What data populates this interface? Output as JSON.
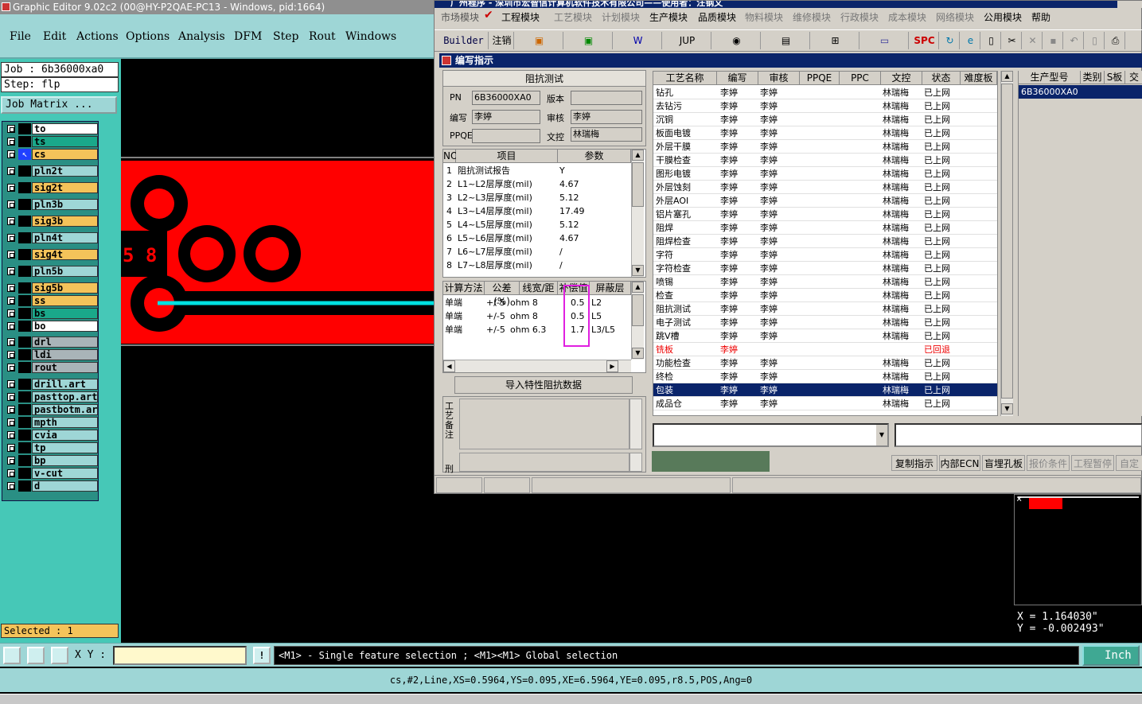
{
  "editor": {
    "title": "Graphic Editor 9.02c2 (00@HY-P2QAE-PC13 - Windows, pid:1664)",
    "menu": [
      "File",
      "Edit",
      "Actions",
      "Options",
      "Analysis",
      "DFM",
      "Step",
      "Rout",
      "Windows"
    ],
    "job": "Job : 6b36000xa0",
    "step": "Step: flp",
    "job_matrix": "Job Matrix ...",
    "layers": [
      {
        "name": "to",
        "color": "#ffffff"
      },
      {
        "name": "ts",
        "color": "#1aa88a"
      },
      {
        "name": "cs",
        "color": "#f4c35a"
      },
      {
        "name": "pln2t",
        "color": "#9ed6d6"
      },
      {
        "name": "sig2t",
        "color": "#f4c35a"
      },
      {
        "name": "pln3b",
        "color": "#9ed6d6"
      },
      {
        "name": "sig3b",
        "color": "#f4c35a"
      },
      {
        "name": "pln4t",
        "color": "#9ed6d6"
      },
      {
        "name": "sig4t",
        "color": "#f4c35a"
      },
      {
        "name": "pln5b",
        "color": "#9ed6d6"
      },
      {
        "name": "sig5b",
        "color": "#f4c35a"
      },
      {
        "name": "ss",
        "color": "#f4c35a"
      },
      {
        "name": "bs",
        "color": "#1aa88a"
      },
      {
        "name": "bo",
        "color": "#ffffff"
      },
      {
        "name": "drl",
        "color": "#a9b4b8"
      },
      {
        "name": "ldi",
        "color": "#a9b4b8"
      },
      {
        "name": "rout",
        "color": "#a9b4b8"
      },
      {
        "name": "drill.art",
        "color": "#9ed6d6"
      },
      {
        "name": "pasttop.art",
        "color": "#9ed6d6"
      },
      {
        "name": "pastbotm.art",
        "color": "#9ed6d6"
      },
      {
        "name": "mpth",
        "color": "#9ed6d6"
      },
      {
        "name": "cvia",
        "color": "#9ed6d6"
      },
      {
        "name": "tp",
        "color": "#9ed6d6"
      },
      {
        "name": "bp",
        "color": "#9ed6d6"
      },
      {
        "name": "v-cut",
        "color": "#9ed6d6"
      },
      {
        "name": "d",
        "color": "#9ed6d6"
      }
    ],
    "selected": "Selected : 1",
    "xy_label": "X Y :",
    "message": "<M1> - Single feature selection ; <M1><M1> Global selection",
    "unit": "Inch",
    "status": "cs,#2,Line,XS=0.5964,YS=0.095,XE=6.5964,YE=0.095,r8.5,POS,Ang=0",
    "coord_x": "X = 1.164030\"",
    "coord_y": "Y = -0.002493\"",
    "canvas_label": "5 8"
  },
  "erp": {
    "title": "广州程序 - 深圳市宏智信计算机软件技术有限公司——使用者：汪钢文",
    "menu": [
      "市场模块",
      "工程模块",
      "工艺模块",
      "计划模块",
      "生产模块",
      "品质模块",
      "物料模块",
      "维修模块",
      "行政模块",
      "成本模块",
      "网络模块",
      "公用模块",
      "帮助"
    ],
    "toolbar": [
      "Builder",
      "注销",
      "JUP",
      "SPC"
    ],
    "subtitle": "编写指示",
    "form_title": "阻抗测试",
    "form": {
      "pn_label": "PN",
      "pn": "6B36000XA0",
      "version_label": "版本",
      "version": "",
      "author_label": "编写",
      "author": "李婷",
      "review_label": "审核",
      "review": "李婷",
      "ppqe_label": "PPQE",
      "ppqe": "",
      "doc_label": "文控",
      "doc": "林瑞梅"
    },
    "params_headers": [
      "NO",
      "项目",
      "参数"
    ],
    "params": [
      {
        "no": "1",
        "item": "阻抗测试报告",
        "val": "Y"
      },
      {
        "no": "2",
        "item": "L1~L2层厚度(mil)",
        "val": "4.67"
      },
      {
        "no": "3",
        "item": "L2~L3层厚度(mil)",
        "val": "5.12"
      },
      {
        "no": "4",
        "item": "L3~L4层厚度(mil)",
        "val": "17.49"
      },
      {
        "no": "5",
        "item": "L4~L5层厚度(mil)",
        "val": "5.12"
      },
      {
        "no": "6",
        "item": "L5~L6层厚度(mil)",
        "val": "4.67"
      },
      {
        "no": "7",
        "item": "L6~L7层厚度(mil)",
        "val": "/"
      },
      {
        "no": "8",
        "item": "L7~L8层厚度(mil)",
        "val": "/"
      }
    ],
    "imp_headers": [
      "计算方法",
      "公差(%)",
      "线宽/距",
      "补偿值",
      "屏蔽层"
    ],
    "imp_rows": [
      {
        "method": "单端",
        "tol": "+/-5",
        "ohm": "ohm 8",
        "comp": "0.5",
        "layer": "L2"
      },
      {
        "method": "单端",
        "tol": "+/-5",
        "ohm": "ohm 8",
        "comp": "0.5",
        "layer": "L5"
      },
      {
        "method": "单端",
        "tol": "+/-5",
        "ohm": "ohm 6.3",
        "comp": "1.7",
        "layer": "L3/L5"
      }
    ],
    "import_btn": "导入特性阻抗数据",
    "notes_label": "工艺备注",
    "notes_label2": "刑",
    "proc_headers": [
      "工艺名称",
      "编写",
      "审核",
      "PPQE",
      "PPC",
      "文控",
      "状态",
      "难度板"
    ],
    "proc_rows": [
      {
        "name": "钻孔",
        "w": "李婷",
        "r": "李婷",
        "d": "林瑞梅",
        "s": "已上网"
      },
      {
        "name": "去钻污",
        "w": "李婷",
        "r": "李婷",
        "d": "林瑞梅",
        "s": "已上网"
      },
      {
        "name": "沉铜",
        "w": "李婷",
        "r": "李婷",
        "d": "林瑞梅",
        "s": "已上网"
      },
      {
        "name": "板面电镀",
        "w": "李婷",
        "r": "李婷",
        "d": "林瑞梅",
        "s": "已上网"
      },
      {
        "name": "外层干膜",
        "w": "李婷",
        "r": "李婷",
        "d": "林瑞梅",
        "s": "已上网"
      },
      {
        "name": "干膜检查",
        "w": "李婷",
        "r": "李婷",
        "d": "林瑞梅",
        "s": "已上网"
      },
      {
        "name": "图形电镀",
        "w": "李婷",
        "r": "李婷",
        "d": "林瑞梅",
        "s": "已上网"
      },
      {
        "name": "外层蚀刻",
        "w": "李婷",
        "r": "李婷",
        "d": "林瑞梅",
        "s": "已上网"
      },
      {
        "name": "外层AOI",
        "w": "李婷",
        "r": "李婷",
        "d": "林瑞梅",
        "s": "已上网"
      },
      {
        "name": "铝片塞孔",
        "w": "李婷",
        "r": "李婷",
        "d": "林瑞梅",
        "s": "已上网"
      },
      {
        "name": "阻焊",
        "w": "李婷",
        "r": "李婷",
        "d": "林瑞梅",
        "s": "已上网"
      },
      {
        "name": "阻焊检查",
        "w": "李婷",
        "r": "李婷",
        "d": "林瑞梅",
        "s": "已上网"
      },
      {
        "name": "字符",
        "w": "李婷",
        "r": "李婷",
        "d": "林瑞梅",
        "s": "已上网"
      },
      {
        "name": "字符检查",
        "w": "李婷",
        "r": "李婷",
        "d": "林瑞梅",
        "s": "已上网"
      },
      {
        "name": "喷锡",
        "w": "李婷",
        "r": "李婷",
        "d": "林瑞梅",
        "s": "已上网"
      },
      {
        "name": "检查",
        "w": "李婷",
        "r": "李婷",
        "d": "林瑞梅",
        "s": "已上网"
      },
      {
        "name": "阻抗测试",
        "w": "李婷",
        "r": "李婷",
        "d": "林瑞梅",
        "s": "已上网"
      },
      {
        "name": "电子测试",
        "w": "李婷",
        "r": "李婷",
        "d": "林瑞梅",
        "s": "已上网"
      },
      {
        "name": "跳V槽",
        "w": "李婷",
        "r": "李婷",
        "d": "林瑞梅",
        "s": "已上网"
      },
      {
        "name": "铣板",
        "w": "李婷",
        "r": "",
        "d": "",
        "s": "已回退"
      },
      {
        "name": "功能检查",
        "w": "李婷",
        "r": "李婷",
        "d": "林瑞梅",
        "s": "已上网"
      },
      {
        "name": "终检",
        "w": "李婷",
        "r": "李婷",
        "d": "林瑞梅",
        "s": "已上网"
      },
      {
        "name": "包装",
        "w": "李婷",
        "r": "李婷",
        "d": "林瑞梅",
        "s": "已上网"
      },
      {
        "name": "成品仓",
        "w": "李婷",
        "r": "李婷",
        "d": "林瑞梅",
        "s": "已上网"
      }
    ],
    "right_headers": [
      "生产型号",
      "类别",
      "S板",
      "交"
    ],
    "right_value": "6B36000XA0",
    "bottom_buttons": [
      "复制指示",
      "内部ECN",
      "盲埋孔板",
      "报价条件",
      "工程暂停",
      "自定义"
    ]
  }
}
